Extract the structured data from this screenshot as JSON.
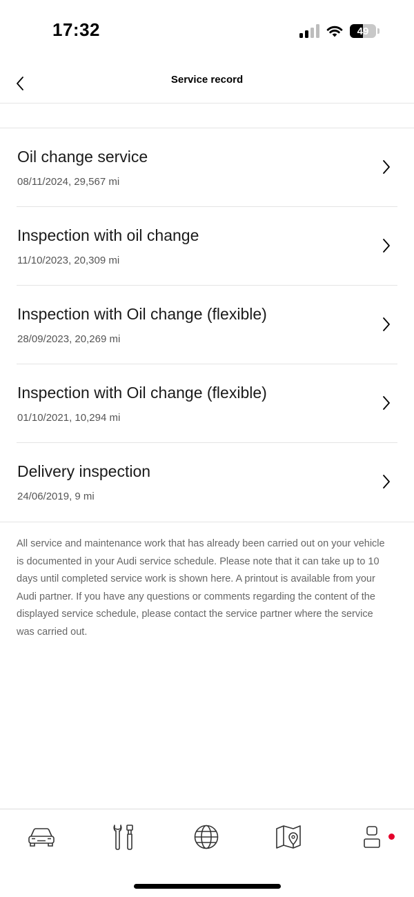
{
  "status_bar": {
    "time": "17:32",
    "battery": "49",
    "battery_level": 0.49,
    "signal_bars_active": 2,
    "icons": [
      "signal-icon",
      "wifi-icon",
      "battery-icon"
    ]
  },
  "header": {
    "title": "Service record",
    "back_icon": "chevron-left-icon"
  },
  "records": [
    {
      "title": "Oil change service",
      "subtitle": "08/11/2024, 29,567 mi"
    },
    {
      "title": "Inspection with oil change",
      "subtitle": "11/10/2023, 20,309 mi"
    },
    {
      "title": "Inspection with Oil change (flexible)",
      "subtitle": "28/09/2023, 20,269 mi"
    },
    {
      "title": "Inspection with Oil change (flexible)",
      "subtitle": "01/10/2021, 10,294 mi"
    },
    {
      "title": "Delivery inspection",
      "subtitle": "24/06/2019, 9 mi"
    }
  ],
  "info_text": "All service and maintenance work that has already been carried out on your vehicle is documented in your Audi service schedule. Please note that it can take up to 10 days until completed service work is shown here. A printout is available from your Audi partner. If you have any questions or comments regarding the content of the displayed service schedule, please contact the service partner where the service was carried out.",
  "bottom_nav": {
    "items": [
      "car-icon",
      "tools-icon",
      "globe-icon",
      "map-icon",
      "profile-icon"
    ],
    "notification_color": "#e4002b"
  }
}
